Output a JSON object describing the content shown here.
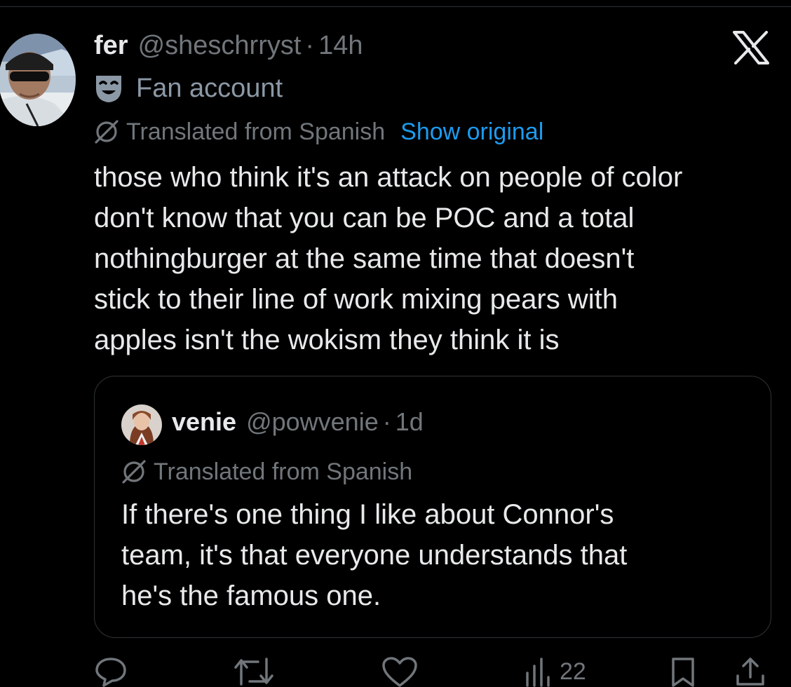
{
  "tweet": {
    "author_name": "fer",
    "author_handle": "@sheschrryst",
    "separator": "·",
    "time": "14h",
    "label": "Fan account",
    "translated_label": "Translated from Spanish",
    "show_original": "Show original",
    "body_lines": [
      "those who think it's an attack on people of color",
      "don't know that you can be POC and a total",
      "nothingburger at the same time that doesn't",
      "stick to their line of work mixing pears with",
      "apples isn't the wokism they think it is"
    ]
  },
  "quote": {
    "author_name": "venie",
    "author_handle": "@powvenie",
    "separator": "·",
    "time": "1d",
    "translated_label": "Translated from Spanish",
    "body_lines": [
      "If there's one thing I like about Connor's",
      "team, it's that everyone understands that",
      "he's the famous one."
    ]
  },
  "actions": {
    "views_count": "22"
  },
  "icons": {
    "brand": "x-logo-icon",
    "label_badge": "theater-mask-icon",
    "translate": "globe-slash-icon",
    "reply": "reply-icon",
    "retweet": "retweet-icon",
    "like": "heart-icon",
    "views": "views-chart-icon",
    "bookmark": "bookmark-icon",
    "share": "share-icon"
  },
  "colors": {
    "background": "#000000",
    "text": "#e7e9ea",
    "secondary": "#71767b",
    "link": "#1d9bf0",
    "border": "#2f3336"
  }
}
